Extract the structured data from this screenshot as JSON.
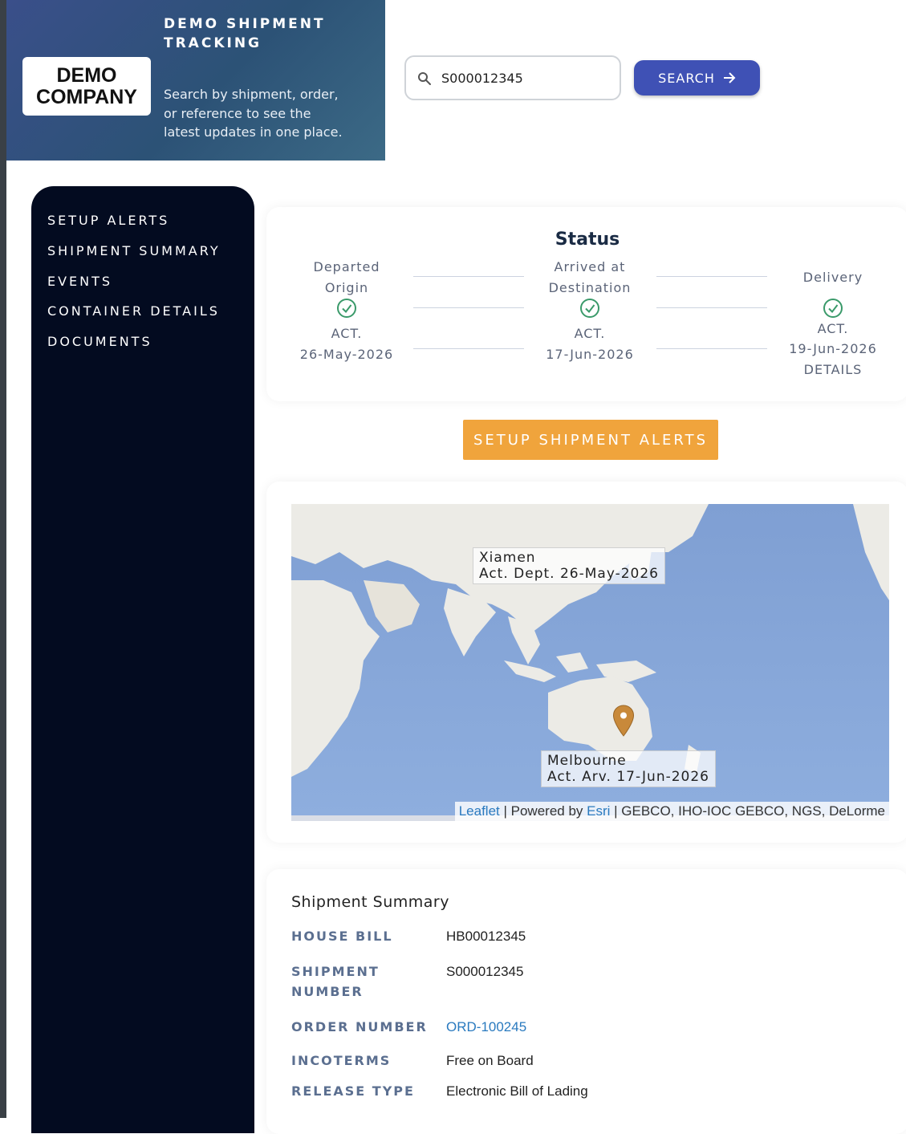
{
  "header": {
    "logo_line1": "DEMO",
    "logo_line2": "COMPANY",
    "title_line1": "DEMO SHIPMENT",
    "title_line2": "TRACKING",
    "description_line1": "Search by shipment, order,",
    "description_line2": "or reference to see the",
    "description_line3": "latest updates in one place."
  },
  "search": {
    "value": "S000012345",
    "button_label": "SEARCH",
    "icon": "search-icon",
    "button_icon": "arrow-right-icon"
  },
  "sidebar": {
    "items": [
      {
        "label": "SETUP ALERTS"
      },
      {
        "label": "SHIPMENT SUMMARY"
      },
      {
        "label": "EVENTS"
      },
      {
        "label": "CONTAINER DETAILS"
      },
      {
        "label": "DOCUMENTS"
      }
    ]
  },
  "status": {
    "title": "Status",
    "milestones": [
      {
        "label_line1": "Departed",
        "label_line2": "Origin",
        "status": "ACT.",
        "date": "26-May-2026"
      },
      {
        "label_line1": "Arrived at",
        "label_line2": "Destination",
        "status": "ACT.",
        "date": "17-Jun-2026"
      },
      {
        "label_line1": "Delivery",
        "status": "ACT.",
        "date": "19-Jun-2026",
        "extra": "DETAILS"
      }
    ],
    "check_icon": "check-circle-icon"
  },
  "alerts_button": {
    "label": "SETUP SHIPMENT ALERTS"
  },
  "map": {
    "origin": {
      "name": "Xiamen",
      "detail": "Act. Dept. 26-May-2026"
    },
    "destination": {
      "name": "Melbourne",
      "detail": "Act. Arv. 17-Jun-2026"
    },
    "attribution": {
      "leaflet": "Leaflet",
      "sep1": " | Powered by ",
      "esri": "Esri",
      "rest": " | GEBCO, IHO-IOC GEBCO, NGS, DeLorme"
    },
    "marker_icon": "map-pin-icon",
    "colors": {
      "ocean": "#8aa8d6",
      "land": "#ecebe6",
      "marker": "#c8893a"
    }
  },
  "summary": {
    "title": "Shipment Summary",
    "rows": [
      {
        "label": "HOUSE BILL",
        "value": "HB00012345"
      },
      {
        "label_line1": "SHIPMENT",
        "label_line2": "NUMBER",
        "value": "S000012345"
      },
      {
        "label": "ORDER NUMBER",
        "value": "ORD-100245"
      },
      {
        "label": "INCOTERMS",
        "value": "Free on Board"
      },
      {
        "label": "RELEASE TYPE",
        "value": "Electronic Bill of Lading"
      }
    ]
  },
  "colors": {
    "sidebar_bg": "#030b20",
    "search_button": "#3f51b5",
    "alerts_button": "#f0a43c",
    "label_blue": "#5b6f90",
    "link": "#2a7abf",
    "check_green": "#3a9a6a"
  }
}
